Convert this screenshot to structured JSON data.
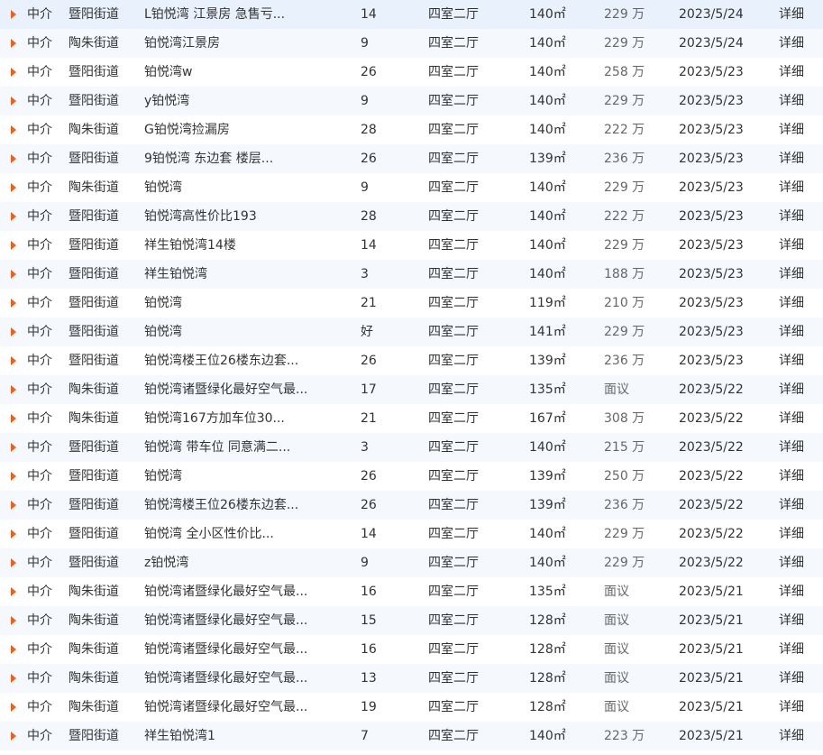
{
  "listings": [
    {
      "source": "中介",
      "area": "暨阳街道",
      "title": "L铂悦湾 江景房 急售亏...",
      "floor": "14",
      "layout": "四室二厅",
      "size": "140㎡",
      "price": "229 万",
      "date": "2023/5/24",
      "detail": "详细"
    },
    {
      "source": "中介",
      "area": "陶朱街道",
      "title": "铂悦湾江景房",
      "floor": "9",
      "layout": "四室二厅",
      "size": "140㎡",
      "price": "229 万",
      "date": "2023/5/24",
      "detail": "详细"
    },
    {
      "source": "中介",
      "area": "暨阳街道",
      "title": "铂悦湾w",
      "floor": "26",
      "layout": "四室二厅",
      "size": "140㎡",
      "price": "258 万",
      "date": "2023/5/23",
      "detail": "详细"
    },
    {
      "source": "中介",
      "area": "暨阳街道",
      "title": "y铂悦湾",
      "floor": "9",
      "layout": "四室二厅",
      "size": "140㎡",
      "price": "229 万",
      "date": "2023/5/23",
      "detail": "详细"
    },
    {
      "source": "中介",
      "area": "陶朱街道",
      "title": "G铂悦湾捡漏房",
      "floor": "28",
      "layout": "四室二厅",
      "size": "140㎡",
      "price": "222 万",
      "date": "2023/5/23",
      "detail": "详细"
    },
    {
      "source": "中介",
      "area": "暨阳街道",
      "title": "9铂悦湾 东边套 楼层...",
      "floor": "26",
      "layout": "四室二厅",
      "size": "139㎡",
      "price": "236 万",
      "date": "2023/5/23",
      "detail": "详细"
    },
    {
      "source": "中介",
      "area": "陶朱街道",
      "title": "铂悦湾",
      "floor": "9",
      "layout": "四室二厅",
      "size": "140㎡",
      "price": "229 万",
      "date": "2023/5/23",
      "detail": "详细"
    },
    {
      "source": "中介",
      "area": "暨阳街道",
      "title": "铂悦湾高性价比193",
      "floor": "28",
      "layout": "四室二厅",
      "size": "140㎡",
      "price": "222 万",
      "date": "2023/5/23",
      "detail": "详细"
    },
    {
      "source": "中介",
      "area": "暨阳街道",
      "title": "祥生铂悦湾14楼",
      "floor": "14",
      "layout": "四室二厅",
      "size": "140㎡",
      "price": "229 万",
      "date": "2023/5/23",
      "detail": "详细"
    },
    {
      "source": "中介",
      "area": "暨阳街道",
      "title": "祥生铂悦湾",
      "floor": "3",
      "layout": "四室二厅",
      "size": "140㎡",
      "price": "188 万",
      "date": "2023/5/23",
      "detail": "详细"
    },
    {
      "source": "中介",
      "area": "暨阳街道",
      "title": "铂悦湾",
      "floor": "21",
      "layout": "四室二厅",
      "size": "119㎡",
      "price": "210 万",
      "date": "2023/5/23",
      "detail": "详细"
    },
    {
      "source": "中介",
      "area": "暨阳街道",
      "title": "铂悦湾",
      "floor": "好",
      "layout": "四室二厅",
      "size": "141㎡",
      "price": "229 万",
      "date": "2023/5/23",
      "detail": "详细"
    },
    {
      "source": "中介",
      "area": "暨阳街道",
      "title": "铂悦湾楼王位26楼东边套...",
      "floor": "26",
      "layout": "四室二厅",
      "size": "139㎡",
      "price": "236 万",
      "date": "2023/5/23",
      "detail": "详细"
    },
    {
      "source": "中介",
      "area": "陶朱街道",
      "title": "铂悦湾诸暨绿化最好空气最...",
      "floor": "17",
      "layout": "四室二厅",
      "size": "135㎡",
      "price": "面议",
      "date": "2023/5/22",
      "detail": "详细"
    },
    {
      "source": "中介",
      "area": "陶朱街道",
      "title": "铂悦湾167方加车位30...",
      "floor": "21",
      "layout": "四室二厅",
      "size": "167㎡",
      "price": "308 万",
      "date": "2023/5/22",
      "detail": "详细"
    },
    {
      "source": "中介",
      "area": "暨阳街道",
      "title": "铂悦湾 带车位 同意满二...",
      "floor": "3",
      "layout": "四室二厅",
      "size": "140㎡",
      "price": "215 万",
      "date": "2023/5/22",
      "detail": "详细"
    },
    {
      "source": "中介",
      "area": "暨阳街道",
      "title": "铂悦湾",
      "floor": "26",
      "layout": "四室二厅",
      "size": "139㎡",
      "price": "250 万",
      "date": "2023/5/22",
      "detail": "详细"
    },
    {
      "source": "中介",
      "area": "暨阳街道",
      "title": "铂悦湾楼王位26楼东边套...",
      "floor": "26",
      "layout": "四室二厅",
      "size": "139㎡",
      "price": "236 万",
      "date": "2023/5/22",
      "detail": "详细"
    },
    {
      "source": "中介",
      "area": "暨阳街道",
      "title": "铂悦湾 全小区性价比...",
      "floor": "14",
      "layout": "四室二厅",
      "size": "140㎡",
      "price": "229 万",
      "date": "2023/5/22",
      "detail": "详细"
    },
    {
      "source": "中介",
      "area": "暨阳街道",
      "title": "z铂悦湾",
      "floor": "9",
      "layout": "四室二厅",
      "size": "140㎡",
      "price": "229 万",
      "date": "2023/5/22",
      "detail": "详细"
    },
    {
      "source": "中介",
      "area": "陶朱街道",
      "title": "铂悦湾诸暨绿化最好空气最...",
      "floor": "16",
      "layout": "四室二厅",
      "size": "135㎡",
      "price": "面议",
      "date": "2023/5/21",
      "detail": "详细"
    },
    {
      "source": "中介",
      "area": "陶朱街道",
      "title": "铂悦湾诸暨绿化最好空气最...",
      "floor": "15",
      "layout": "四室二厅",
      "size": "128㎡",
      "price": "面议",
      "date": "2023/5/21",
      "detail": "详细"
    },
    {
      "source": "中介",
      "area": "陶朱街道",
      "title": "铂悦湾诸暨绿化最好空气最...",
      "floor": "16",
      "layout": "四室二厅",
      "size": "128㎡",
      "price": "面议",
      "date": "2023/5/21",
      "detail": "详细"
    },
    {
      "source": "中介",
      "area": "陶朱街道",
      "title": "铂悦湾诸暨绿化最好空气最...",
      "floor": "13",
      "layout": "四室二厅",
      "size": "128㎡",
      "price": "面议",
      "date": "2023/5/21",
      "detail": "详细"
    },
    {
      "source": "中介",
      "area": "陶朱街道",
      "title": "铂悦湾诸暨绿化最好空气最...",
      "floor": "19",
      "layout": "四室二厅",
      "size": "128㎡",
      "price": "面议",
      "date": "2023/5/21",
      "detail": "详细"
    },
    {
      "source": "中介",
      "area": "暨阳街道",
      "title": "祥生铂悦湾1",
      "floor": "7",
      "layout": "四室二厅",
      "size": "140㎡",
      "price": "223 万",
      "date": "2023/5/21",
      "detail": "详细"
    }
  ],
  "colors": {
    "accent": "#e8621a",
    "row_alt_bg": "#f5f9fe",
    "text": "#333333",
    "price_text": "#666666"
  },
  "icons": {
    "row_marker": "triangle-right-icon"
  }
}
